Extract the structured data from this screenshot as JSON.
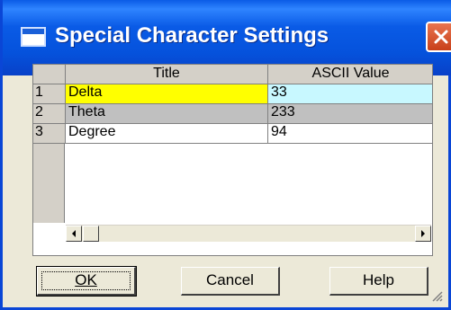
{
  "window": {
    "title": "Special Character Settings",
    "close_icon": "close-icon",
    "accent": "#0a5be6"
  },
  "grid": {
    "columns": [
      "Title",
      "ASCII Value"
    ],
    "rows": [
      {
        "num": "1",
        "title": "Delta",
        "value": "33",
        "title_bg": "#ffff00",
        "value_bg": "#c8f8ff"
      },
      {
        "num": "2",
        "title": "Theta",
        "value": "233",
        "title_bg": "#c0c0c0",
        "value_bg": "#c0c0c0"
      },
      {
        "num": "3",
        "title": "Degree",
        "value": "94",
        "title_bg": "#ffffff",
        "value_bg": "#ffffff"
      }
    ]
  },
  "buttons": {
    "ok": "OK",
    "cancel": "Cancel",
    "help": "Help"
  }
}
